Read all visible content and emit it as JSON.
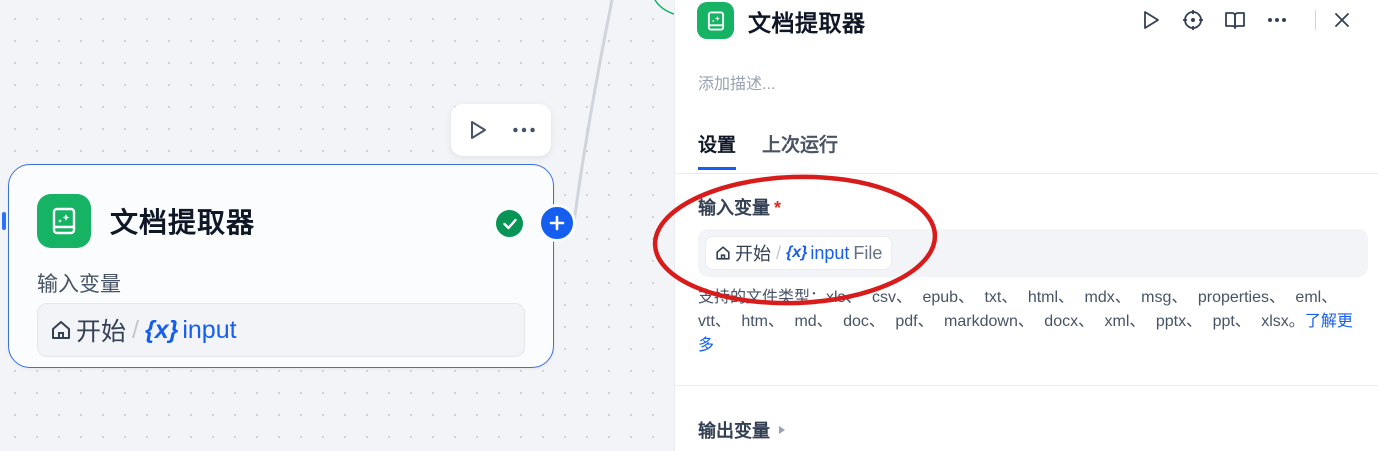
{
  "canvas": {
    "node": {
      "title": "文档提取器",
      "var_label": "输入变量",
      "var_source": "开始",
      "var_separator": "/",
      "var_brace": "{x}",
      "var_name": "input",
      "icon": "document-extractor-icon",
      "status_icon": "check-circle-icon",
      "add_icon": "plus-icon"
    },
    "toolbar": {
      "run_icon": "play-icon",
      "more_icon": "more-horizontal-icon"
    }
  },
  "panel": {
    "title": "文档提取器",
    "description_placeholder": "添加描述...",
    "tabs": [
      {
        "label": "设置",
        "active": true
      },
      {
        "label": "上次运行",
        "active": false
      }
    ],
    "input_section": {
      "title": "输入变量",
      "required_mark": "*",
      "chip": {
        "source": "开始",
        "separator": "/",
        "brace": "{x}",
        "name": "input",
        "type": "File"
      },
      "support_text": "支持的文件类型：xls、 csv、 epub、 txt、 html、 mdx、 msg、 properties、 eml、 vtt、 htm、 md、 doc、 pdf、 markdown、 docx、 xml、 pptx、 ppt、 xlsx。",
      "learn_more": "了解更多"
    },
    "output_section": {
      "title": "输出变量"
    },
    "actions": [
      "play-icon",
      "locate-icon",
      "book-open-icon",
      "more-horizontal-icon",
      "close-icon"
    ]
  },
  "colors": {
    "accent": "#155eef",
    "node_icon_bg": "#16b364",
    "success": "#079455",
    "required": "#d92d20",
    "annotation": "#d81b1b"
  }
}
